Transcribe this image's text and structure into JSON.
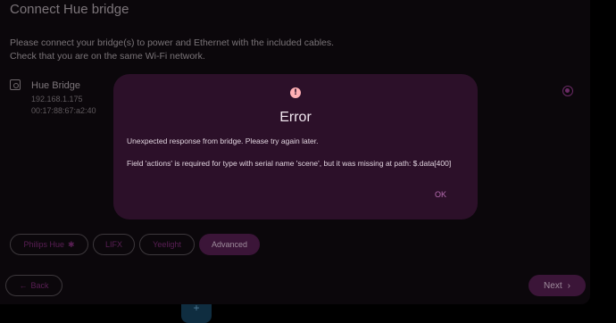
{
  "page": {
    "title": "Connect Hue bridge",
    "instructions": [
      "Please connect your bridge(s) to power and Ethernet with the included cables.",
      "Check that you are on the same Wi-Fi network."
    ]
  },
  "bridge": {
    "icon": "bridge-icon",
    "name": "Hue Bridge",
    "ip": "192.168.1.175",
    "mac": "00:17:88:67:a2:40",
    "selected": true
  },
  "chips": [
    {
      "label": "Philips Hue",
      "icon": "bluetooth-icon",
      "icon_glyph": "✱",
      "active": false
    },
    {
      "label": "LIFX",
      "active": false
    },
    {
      "label": "Yeelight",
      "active": false
    },
    {
      "label": "Advanced",
      "active": true
    }
  ],
  "nav": {
    "back_label": "Back",
    "back_icon": "←",
    "next_label": "Next",
    "next_icon": "›"
  },
  "fab": {
    "icon": "plus-icon",
    "glyph": "+"
  },
  "dialog": {
    "icon": "!",
    "title": "Error",
    "message_line1": "Unexpected response from bridge. Please try again later.",
    "message_line2": "Field 'actions' is required for type with serial name 'scene', but it was missing at path: $.data[400]",
    "ok_label": "OK"
  },
  "colors": {
    "accent": "#b66cb0",
    "dialog_bg": "#2c1029",
    "error": "#ffb0b4"
  }
}
